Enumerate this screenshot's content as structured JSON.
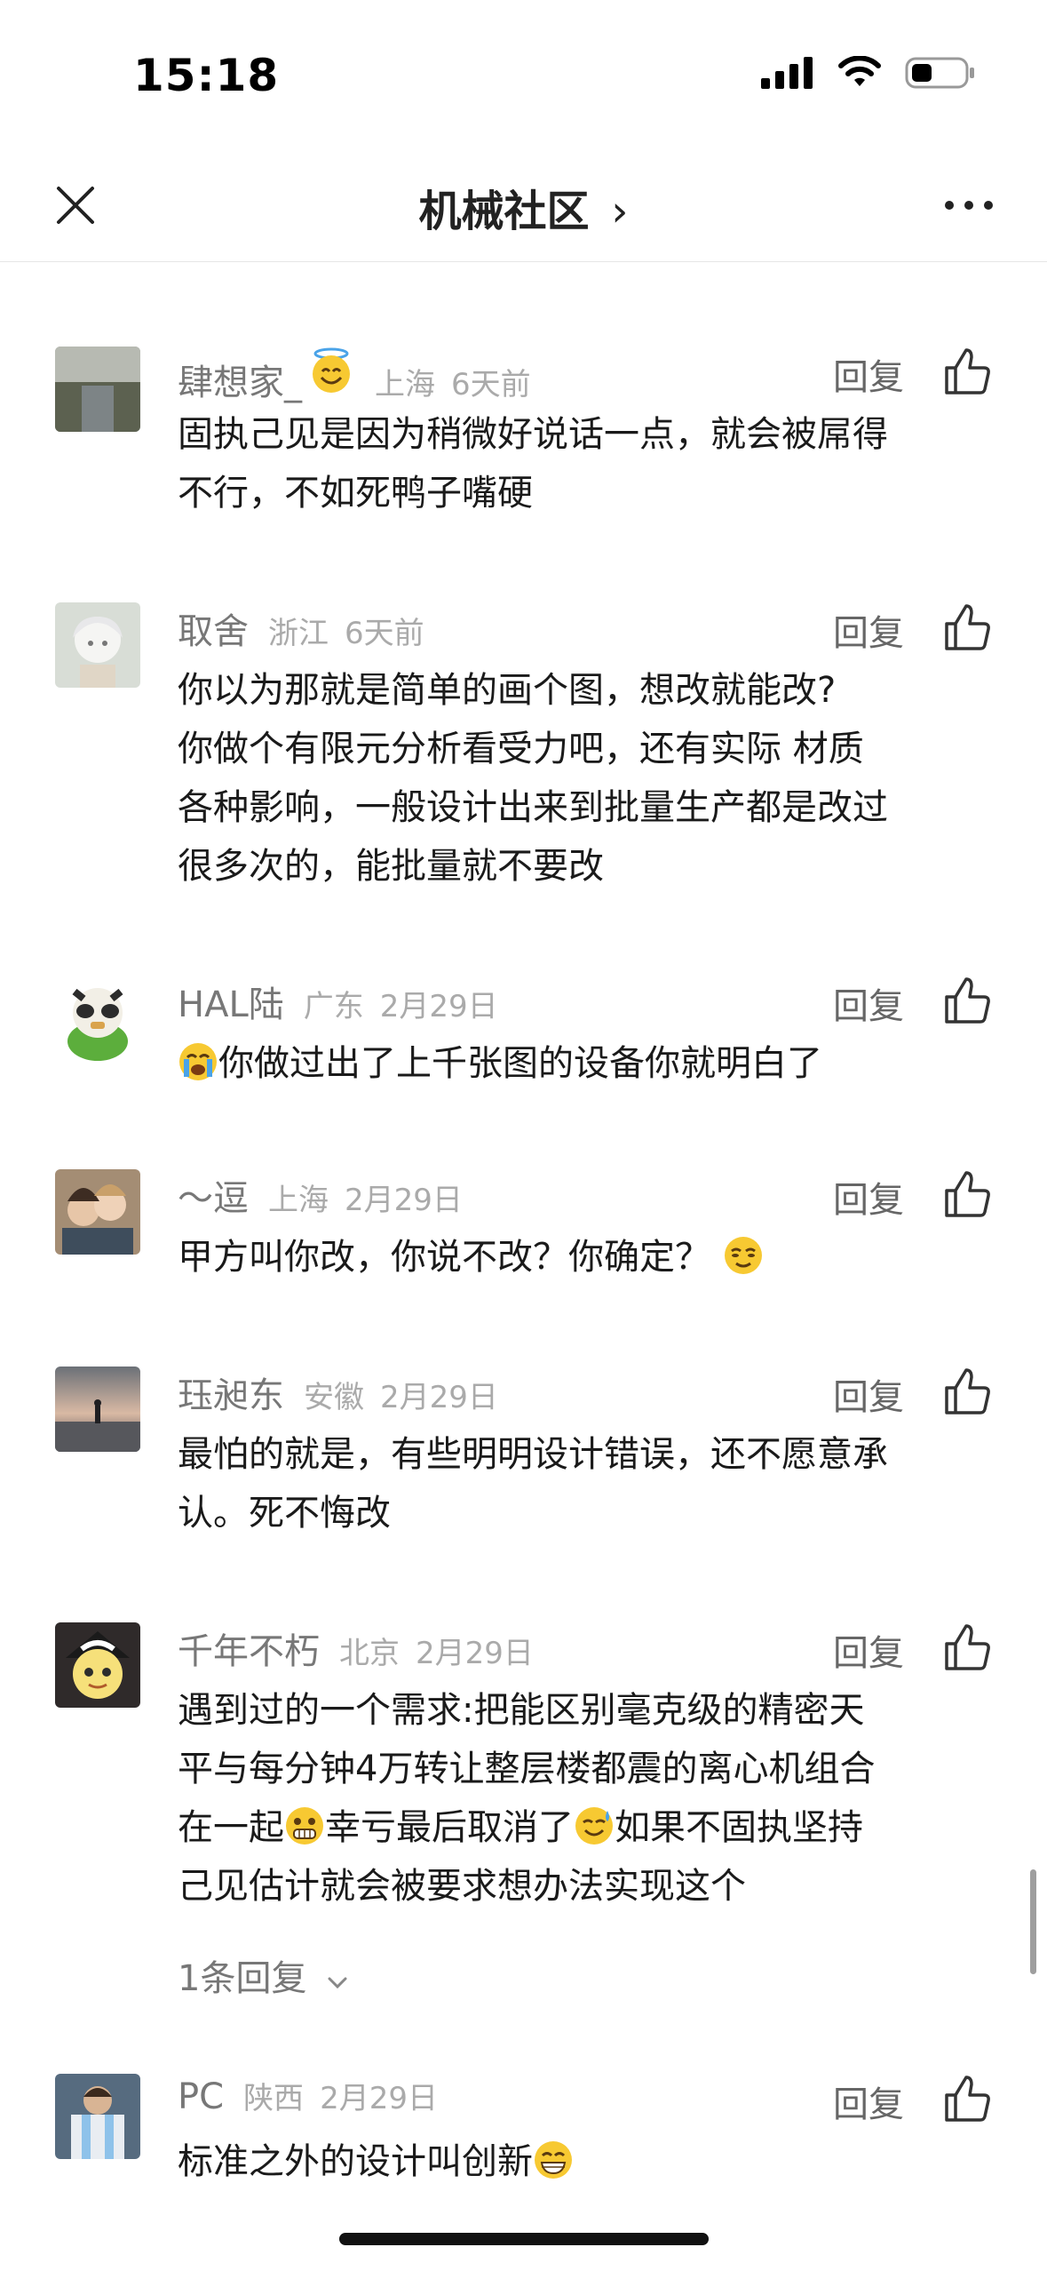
{
  "status": {
    "time": "15:18"
  },
  "nav": {
    "title": "机械社区",
    "title_chevron": "›"
  },
  "comments": [
    {
      "name": "肆想家_",
      "loc": "上海",
      "time": "6天前",
      "reply": "回复",
      "lines": [
        "固执己见是因为稍微好说话一点，就会被屌得",
        "不行，不如死鸭子嘴硬"
      ]
    },
    {
      "name": "取舍",
      "loc": "浙江",
      "time": "6天前",
      "reply": "回复",
      "lines": [
        "你以为那就是简单的画个图，想改就能改?",
        "你做个有限元分析看受力吧，还有实际 材质",
        "各种影响，一般设计出来到批量生产都是改过",
        "很多次的，能批量就不要改"
      ]
    },
    {
      "name": "HAL陆",
      "loc": "广东",
      "time": "2月29日",
      "reply": "回复",
      "lines": [
        "你做过出了上千张图的设备你就明白了"
      ]
    },
    {
      "name": "～逗",
      "loc": "上海",
      "time": "2月29日",
      "reply": "回复",
      "lines": [
        "甲方叫你改，你说不改？你确定？"
      ]
    },
    {
      "name": "珏昶东",
      "loc": "安徽",
      "time": "2月29日",
      "reply": "回复",
      "lines": [
        "最怕的就是，有些明明设计错误，还不愿意承",
        "认。死不悔改"
      ]
    },
    {
      "name": "千年不朽",
      "loc": "北京",
      "time": "2月29日",
      "reply": "回复",
      "lines": [
        "遇到过的一个需求:把能区别毫克级的精密天",
        "平与每分钟4万转让整层楼都震的离心机组合",
        "在一起",
        "幸亏最后取消了",
        "如果不固执坚持",
        "己见估计就会被要求想办法实现这个"
      ],
      "replies": "1条回复"
    },
    {
      "name": "PC",
      "loc": "陕西",
      "time": "2月29日",
      "reply": "回复",
      "lines": [
        "标准之外的设计叫创新"
      ]
    }
  ]
}
